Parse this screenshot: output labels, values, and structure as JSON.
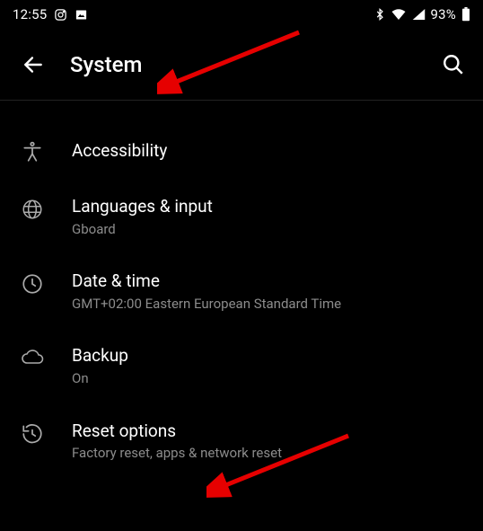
{
  "statusbar": {
    "time": "12:55",
    "battery": "93%",
    "icons_left": [
      "instagram-icon",
      "picture-icon"
    ],
    "icons_right": [
      "bluetooth-icon",
      "wifi-icon",
      "cell-signal-icon",
      "battery-icon"
    ]
  },
  "appbar": {
    "title": "System"
  },
  "items": [
    {
      "icon": "accessibility-icon",
      "title": "Accessibility",
      "sub": ""
    },
    {
      "icon": "globe-icon",
      "title": "Languages & input",
      "sub": "Gboard"
    },
    {
      "icon": "clock-icon",
      "title": "Date & time",
      "sub": "GMT+02:00 Eastern European Standard Time"
    },
    {
      "icon": "cloud-icon",
      "title": "Backup",
      "sub": "On"
    },
    {
      "icon": "history-icon",
      "title": "Reset options",
      "sub": "Factory reset, apps & network reset"
    }
  ]
}
